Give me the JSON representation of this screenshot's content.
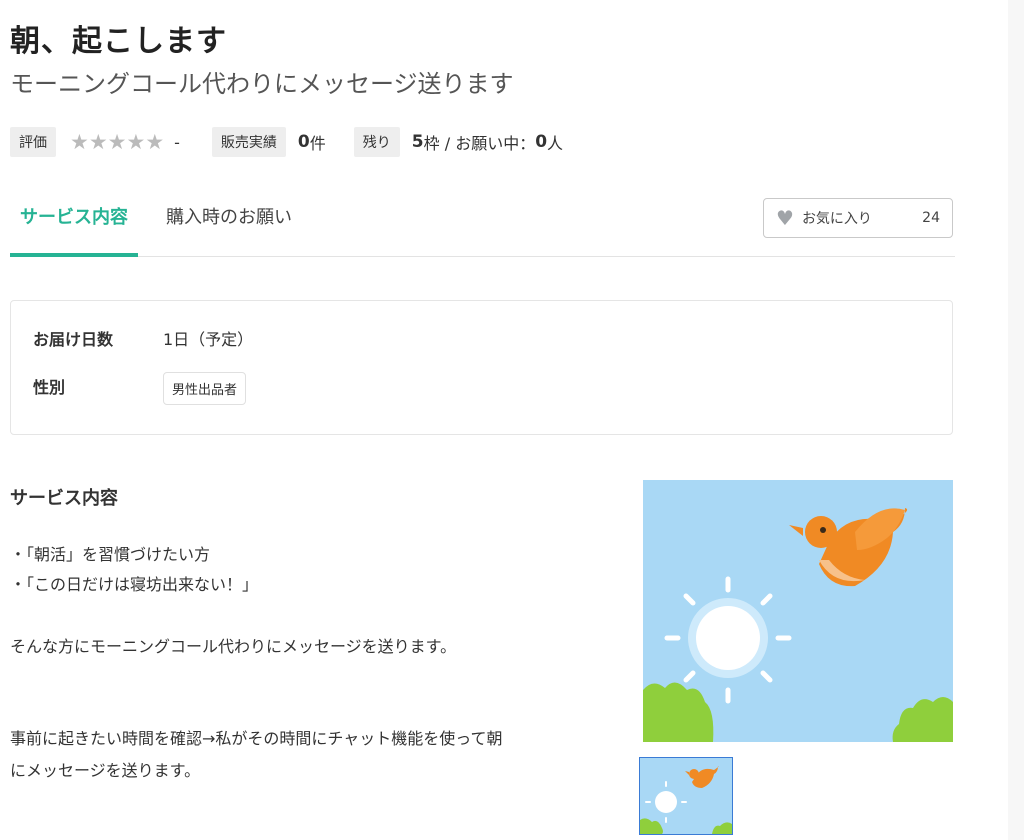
{
  "header": {
    "title": "朝、起こします",
    "subtitle": "モーニングコール代わりにメッセージ送ります"
  },
  "meta": {
    "rating_label": "評価",
    "rating_stars": 0,
    "rating_value": "-",
    "sales_label": "販売実績",
    "sales_count": "0",
    "sales_unit": "件",
    "remaining_label": "残り",
    "remaining_count": "5",
    "remaining_unit": "枠 / お願い中：",
    "requesting_count": "0",
    "requesting_unit": "人"
  },
  "tabs": [
    {
      "label": "サービス内容",
      "active": true
    },
    {
      "label": "購入時のお願い",
      "active": false
    }
  ],
  "favorite": {
    "label": "お気に入り",
    "count": "24"
  },
  "info": {
    "delivery_label": "お届け日数",
    "delivery_value": "1日（予定）",
    "gender_label": "性別",
    "gender_value": "男性出品者"
  },
  "description": {
    "title": "サービス内容",
    "bullets": [
      "・「朝活」を習慣づけたい方",
      "・「この日だけは寝坊出来ない！」"
    ],
    "paragraph1": "そんな方にモーニングコール代わりにメッセージを送ります。",
    "paragraph2_line1": "事前に起きたい時間を確認→私がその時間にチャット機能を使って朝",
    "paragraph2_line2": "にメッセージを送ります。"
  },
  "colors": {
    "accent": "#26b394",
    "sky": "#a9d8f5",
    "bird": "#f08a24"
  },
  "icons": [
    "heart-icon",
    "star-icon"
  ]
}
